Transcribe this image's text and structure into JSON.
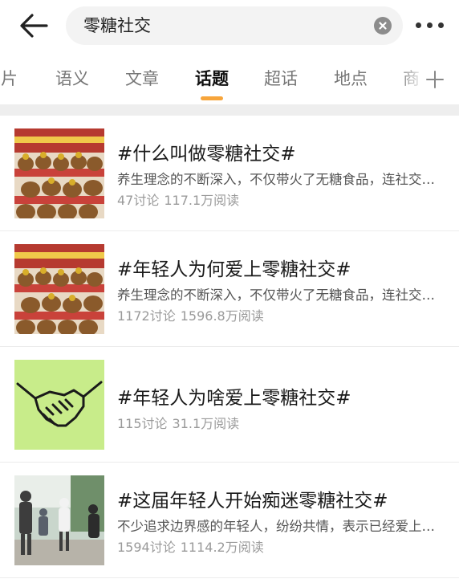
{
  "search": {
    "query": "零糖社交"
  },
  "tabs": [
    {
      "label": "图片",
      "active": false
    },
    {
      "label": "语义",
      "active": false
    },
    {
      "label": "文章",
      "active": false
    },
    {
      "label": "话题",
      "active": true
    },
    {
      "label": "超话",
      "active": false
    },
    {
      "label": "地点",
      "active": false
    },
    {
      "label": "商",
      "active": false
    }
  ],
  "colors": {
    "accent": "#f7a53b",
    "divider": "#eeeeee",
    "handshake_bg": "#c8ec8a"
  },
  "icons": {
    "back": "arrow-left-icon",
    "clear": "clear-circle-icon",
    "more": "more-dots-icon",
    "add_tab": "plus-icon"
  },
  "topics": [
    {
      "title": "#什么叫做零糖社交#",
      "desc": "养生理念的不断深入，不仅带火了无糖食品，连社交也开始讲究零糖了",
      "discussions": "47讨论",
      "reads": "117.1万阅读",
      "thumb": "capybara-plush-photo"
    },
    {
      "title": "#年轻人为何爱上零糖社交#",
      "desc": "养生理念的不断深入，不仅带火了无糖食品，连社交也开始讲究零糖了",
      "discussions": "1172讨论",
      "reads": "1596.8万阅读",
      "thumb": "capybara-plush-photo"
    },
    {
      "title": "#年轻人为啥爱上零糖社交#",
      "desc": "",
      "discussions": "115讨论",
      "reads": "31.1万阅读",
      "thumb": "handshake-illustration"
    },
    {
      "title": "#这届年轻人开始痴迷零糖社交#",
      "desc": "不少追求边界感的年轻人，纷纷共情，表示已经爱上这种社交方式",
      "discussions": "1594讨论",
      "reads": "1114.2万阅读",
      "thumb": "friends-walking-photo"
    }
  ]
}
